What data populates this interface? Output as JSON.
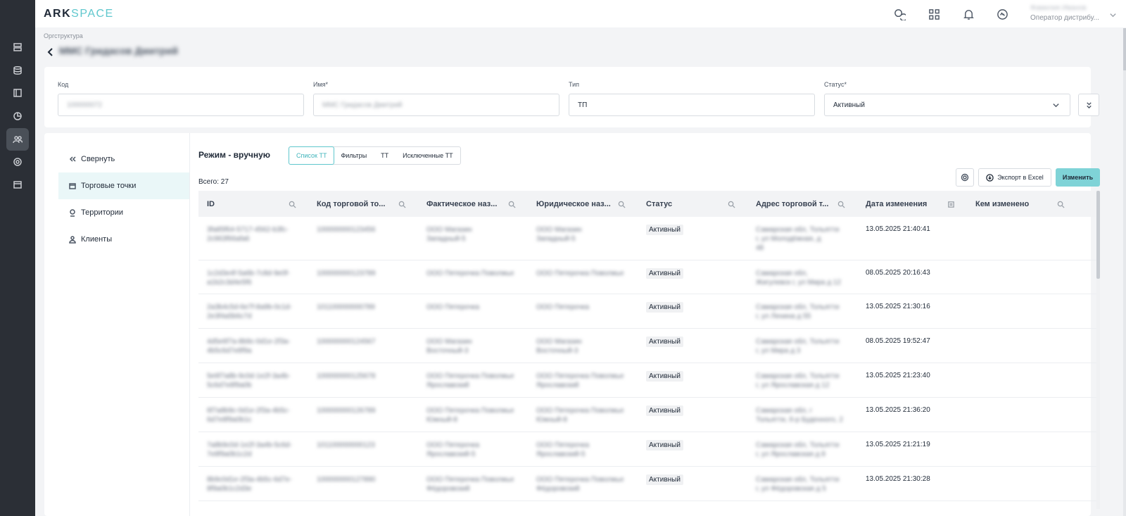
{
  "app": {
    "logo_main": "ARK",
    "logo_accent": "SPACE",
    "user_name": "Фамилия Иванов",
    "user_role": "Оператор дистрибу..."
  },
  "page": {
    "breadcrumb": "Оргструктура",
    "title": "ММС Гридасов Дмитрий"
  },
  "form": {
    "code_label": "Код",
    "code_value": "100000072",
    "name_label": "Имя*",
    "name_value": "ММС Гридасов Дмитрий",
    "type_label": "Тип",
    "type_value": "ТП",
    "status_label": "Статус*",
    "status_value": "Активный"
  },
  "sidebar": {
    "collapse": "Свернуть",
    "items": [
      {
        "label": "Торговые точки",
        "active": true
      },
      {
        "label": "Территории",
        "active": false
      },
      {
        "label": "Клиенты",
        "active": false
      }
    ]
  },
  "mode": {
    "label": "Режим - вручную",
    "tabs": [
      {
        "label": "Список ТТ",
        "active": true
      },
      {
        "label": "Фильтры",
        "active": false
      },
      {
        "label": "ТТ",
        "active": false
      },
      {
        "label": "Исключенные ТТ",
        "active": false
      }
    ]
  },
  "toolbar": {
    "total": "Всего: 27",
    "export_label": "Экспорт в Excel",
    "edit_label": "Изменить"
  },
  "table": {
    "columns": [
      "ID",
      "Код торговой то...",
      "Фактическое наз...",
      "Юридическое наз...",
      "Статус",
      "Адрес торговой т...",
      "Дата изменения",
      "Кем изменено"
    ],
    "rows": [
      {
        "id": [
          "3fa85f64-5717-4562-b3fc-",
          "2c963f66afa6"
        ],
        "code": "100000000123456",
        "fact": [
          "ООО Магазин",
          "Западный-5"
        ],
        "legal": [
          "ООО Магазин",
          "Западный-5"
        ],
        "status": "Активный",
        "address": [
          "Самарская обл, Тольятти",
          "г, ул Молодёжная, д",
          "48"
        ],
        "date": "13.05.2025 21:40:41",
        "by": ""
      },
      {
        "id": [
          "1c2d3e4f-5a6b-7c8d-9e0f-",
          "a1b2c3d4e5f6"
        ],
        "code": "100000000123789",
        "fact": [
          "ООО Пятерочка Поволжье"
        ],
        "legal": [
          "ООО Пятерочка Поволжье"
        ],
        "status": "Активный",
        "address": [
          "Самарская обл,",
          "Жигулевск г, ул Мира д 12"
        ],
        "date": "08.05.2025 20:16:43",
        "by": ""
      },
      {
        "id": [
          "2a3b4c5d-6e7f-8a9b-0c1d-",
          "2e3f4a5b6c7d"
        ],
        "code": "101100000000789",
        "fact": [
          "ООО Пятерочка"
        ],
        "legal": [
          "ООО Пятерочка"
        ],
        "status": "Активный",
        "address": [
          "Самарская обл, Тольятти",
          "г, ул Ленина д 55"
        ],
        "date": "13.05.2025 21:30:16",
        "by": ""
      },
      {
        "id": [
          "4d5e6f7a-8b9c-0d1e-2f3a-",
          "4b5c6d7e8f9a"
        ],
        "code": "100000000124567",
        "fact": [
          "ООО Магазин",
          "Восточный-3"
        ],
        "legal": [
          "ООО Магазин",
          "Восточный-3"
        ],
        "status": "Активный",
        "address": [
          "Самарская обл, Тольятти",
          "г, ул Мира д 3"
        ],
        "date": "08.05.2025 19:52:47",
        "by": ""
      },
      {
        "id": [
          "5e6f7a8b-9c0d-1e2f-3a4b-",
          "5c6d7e8f9a0b"
        ],
        "code": "100000000125678",
        "fact": [
          "ООО Пятерочка Поволжье",
          "Ярославский"
        ],
        "legal": [
          "ООО Пятерочка Поволжье",
          "Ярославский"
        ],
        "status": "Активный",
        "address": [
          "Самарская обл, Тольятти",
          "г, ул Ярославская д 12"
        ],
        "date": "13.05.2025 21:23:40",
        "by": ""
      },
      {
        "id": [
          "6f7a8b9c-0d1e-2f3a-4b5c-",
          "6d7e8f9a0b1c"
        ],
        "code": "100000000126789",
        "fact": [
          "ООО Пятерочка Поволжье",
          "Южный-8"
        ],
        "legal": [
          "ООО Пятерочка Поволжье",
          "Южный-8"
        ],
        "status": "Активный",
        "address": [
          "Самарская обл, г",
          "Тольятти, б-р Буденного, 2"
        ],
        "date": "13.05.2025 21:36:20",
        "by": ""
      },
      {
        "id": [
          "7a8b9c0d-1e2f-3a4b-5c6d-",
          "7e8f9a0b1c2d"
        ],
        "code": "101100000000123",
        "fact": [
          "ООО Пятерочка",
          "Ярославский-5"
        ],
        "legal": [
          "ООО Пятерочка",
          "Ярославский-5"
        ],
        "status": "Активный",
        "address": [
          "Самарская обл, Тольятти",
          "г, ул Ярославская д 8"
        ],
        "date": "13.05.2025 21:21:19",
        "by": ""
      },
      {
        "id": [
          "8b9c0d1e-2f3a-4b5c-6d7e-",
          "8f9a0b1c2d3e"
        ],
        "code": "100000000127890",
        "fact": [
          "ООО Пятерочка Поволжье",
          "Фёдоровский"
        ],
        "legal": [
          "ООО Пятерочка Поволжье",
          "Фёдоровский"
        ],
        "status": "Активный",
        "address": [
          "Самарская обл, Тольятти",
          "г, ул Фёдоровская д 5"
        ],
        "date": "13.05.2025 21:30:28",
        "by": ""
      }
    ]
  }
}
